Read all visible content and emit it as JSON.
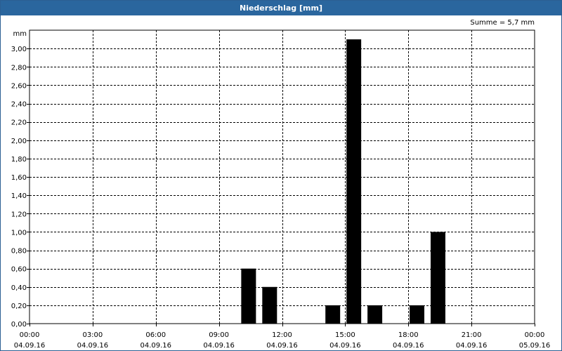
{
  "window": {
    "title": "Niederschlag [mm]"
  },
  "summary": {
    "sum_label": "Summe = 5,7 mm"
  },
  "chart_data": {
    "type": "bar",
    "title": "Niederschlag [mm]",
    "ylabel": "mm",
    "xlabel": "",
    "ylim": [
      0,
      3.2
    ],
    "grid": true,
    "y_ticks": [
      0,
      0.2,
      0.4,
      0.6,
      0.8,
      1.0,
      1.2,
      1.4,
      1.6,
      1.8,
      2.0,
      2.2,
      2.4,
      2.6,
      2.8,
      3.0
    ],
    "y_tick_labels": [
      "0,00",
      "0,20",
      "0,40",
      "0,60",
      "0,80",
      "1,00",
      "1,20",
      "1,40",
      "1,60",
      "1,80",
      "2,00",
      "2,20",
      "2,40",
      "2,60",
      "2,80",
      "3,00"
    ],
    "x_range_hours": [
      0,
      24
    ],
    "x_ticks_hours": [
      0,
      3,
      6,
      9,
      12,
      15,
      18,
      21,
      24
    ],
    "x_tick_labels": [
      {
        "time": "00:00",
        "date": "04.09.16"
      },
      {
        "time": "03:00",
        "date": "04.09.16"
      },
      {
        "time": "06:00",
        "date": "04.09.16"
      },
      {
        "time": "09:00",
        "date": "04.09.16"
      },
      {
        "time": "12:00",
        "date": "04.09.16"
      },
      {
        "time": "15:00",
        "date": "04.09.16"
      },
      {
        "time": "18:00",
        "date": "04.09.16"
      },
      {
        "time": "21:00",
        "date": "04.09.16"
      },
      {
        "time": "00:00",
        "date": "05.09.16"
      }
    ],
    "bars": [
      {
        "start_hour": 10,
        "value": 0.6
      },
      {
        "start_hour": 11,
        "value": 0.4
      },
      {
        "start_hour": 14,
        "value": 0.2
      },
      {
        "start_hour": 15,
        "value": 3.1
      },
      {
        "start_hour": 16,
        "value": 0.2
      },
      {
        "start_hour": 18,
        "value": 0.2
      },
      {
        "start_hour": 19,
        "value": 1.0
      }
    ],
    "colors": {
      "bar": "#000000",
      "title_bar": "#2a669e",
      "border": "#2b5f93"
    }
  }
}
